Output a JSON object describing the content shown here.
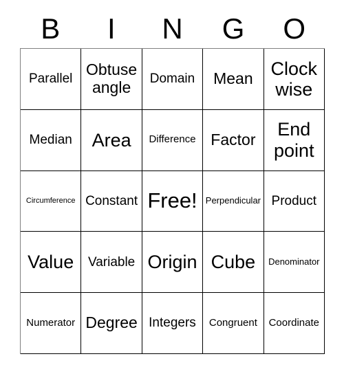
{
  "header": {
    "letters": [
      "B",
      "I",
      "N",
      "G",
      "O"
    ]
  },
  "grid": {
    "rows": [
      [
        {
          "label": "Parallel",
          "size": "m"
        },
        {
          "label": "Obtuse angle",
          "size": "l"
        },
        {
          "label": "Domain",
          "size": "m"
        },
        {
          "label": "Mean",
          "size": "l"
        },
        {
          "label": "Clock wise",
          "size": "xl"
        }
      ],
      [
        {
          "label": "Median",
          "size": "m"
        },
        {
          "label": "Area",
          "size": "xl"
        },
        {
          "label": "Difference",
          "size": "s"
        },
        {
          "label": "Factor",
          "size": "l"
        },
        {
          "label": "End point",
          "size": "xl"
        }
      ],
      [
        {
          "label": "Circumference",
          "size": "xxs"
        },
        {
          "label": "Constant",
          "size": "m"
        },
        {
          "label": "Free!",
          "size": "xxl"
        },
        {
          "label": "Perpendicular",
          "size": "xs"
        },
        {
          "label": "Product",
          "size": "m"
        }
      ],
      [
        {
          "label": "Value",
          "size": "xl"
        },
        {
          "label": "Variable",
          "size": "m"
        },
        {
          "label": "Origin",
          "size": "xl"
        },
        {
          "label": "Cube",
          "size": "xl"
        },
        {
          "label": "Denominator",
          "size": "xs"
        }
      ],
      [
        {
          "label": "Numerator",
          "size": "s"
        },
        {
          "label": "Degree",
          "size": "l"
        },
        {
          "label": "Integers",
          "size": "m"
        },
        {
          "label": "Congruent",
          "size": "s"
        },
        {
          "label": "Coordinate",
          "size": "s"
        }
      ]
    ]
  },
  "colors": {
    "background": "#ffffff",
    "grid_line": "#000000",
    "text": "#000000"
  }
}
